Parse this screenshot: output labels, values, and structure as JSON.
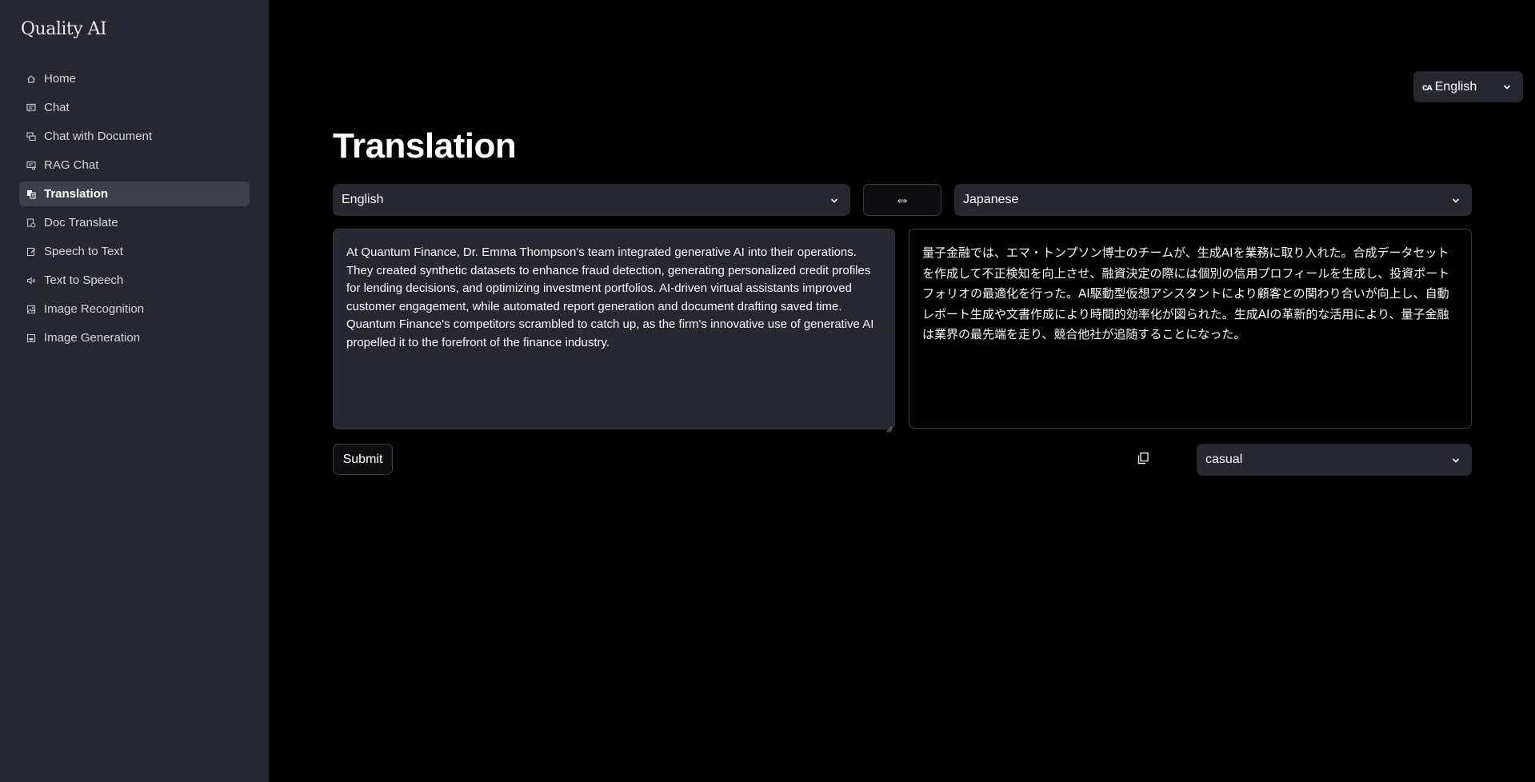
{
  "brand": "Quality AI",
  "nav": [
    {
      "label": "Home",
      "icon": "home-icon"
    },
    {
      "label": "Chat",
      "icon": "chat-icon"
    },
    {
      "label": "Chat with Document",
      "icon": "chat-document-icon"
    },
    {
      "label": "RAG Chat",
      "icon": "rag-chat-icon"
    },
    {
      "label": "Translation",
      "icon": "translation-icon",
      "active": true
    },
    {
      "label": "Doc Translate",
      "icon": "doc-translate-icon"
    },
    {
      "label": "Speech to Text",
      "icon": "speech-to-text-icon"
    },
    {
      "label": "Text to Speech",
      "icon": "text-to-speech-icon"
    },
    {
      "label": "Image Recognition",
      "icon": "image-recognition-icon"
    },
    {
      "label": "Image Generation",
      "icon": "image-generation-icon"
    }
  ],
  "ui_language": {
    "glyph": "ᴄᴀ",
    "value": "English"
  },
  "page": {
    "title": "Translation",
    "source_language": "English",
    "target_language": "Japanese",
    "swap_symbol": "⇔",
    "source_text": "At Quantum Finance, Dr. Emma Thompson's team integrated generative AI into their operations. They created synthetic datasets to enhance fraud detection, generating personalized credit profiles for lending decisions, and optimizing investment portfolios. AI-driven virtual assistants improved customer engagement, while automated report generation and document drafting saved time. Quantum Finance's competitors scrambled to catch up, as the firm's innovative use of generative AI propelled it to the forefront of the finance industry.",
    "translated_text": "量子金融では、エマ・トンプソン博士のチームが、生成AIを業務に取り入れた。合成データセットを作成して不正検知を向上させ、融資決定の際には個別の信用プロフィールを生成し、投資ポートフォリオの最適化を行った。AI駆動型仮想アシスタントにより顧客との関わり合いが向上し、自動レポート生成や文書作成により時間的効率化が図られた。生成AIの革新的な活用により、量子金融は業界の最先端を走り、競合他社が追随することになった。",
    "submit_label": "Submit",
    "tone": "casual"
  },
  "colors": {
    "sidebar_bg": "#262730",
    "active_item_bg": "#3e404c",
    "page_bg": "#000000"
  }
}
